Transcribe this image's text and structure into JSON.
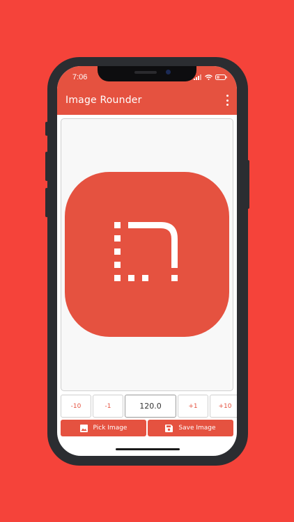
{
  "status_bar": {
    "time": "7:06"
  },
  "app_bar": {
    "title": "Image Rounder"
  },
  "icons": {
    "more": "more-vert-icon",
    "rounded_corner": "rounded-corner-icon",
    "pick": "image-icon",
    "save": "save-icon"
  },
  "controls": {
    "minus_10": "-10",
    "minus_1": "-1",
    "value": "120.0",
    "plus_1": "+1",
    "plus_10": "+10"
  },
  "actions": {
    "pick_image": "Pick Image",
    "save_image": "Save Image"
  },
  "colors": {
    "background": "#f5433a",
    "accent": "#e55240"
  }
}
